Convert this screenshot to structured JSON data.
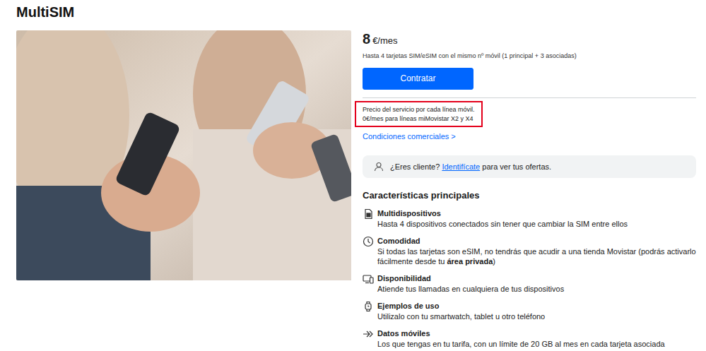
{
  "title": "MultiSIM",
  "price": {
    "amount": "8",
    "unit": "€/mes",
    "note": "Hasta 4 tarjetas SIM/eSIM con el mismo nº móvil (1 principal + 3 asociadas)"
  },
  "cta": "Contratar",
  "pricing_notes": {
    "highlighted": true,
    "lines": [
      "Precio del servicio por cada línea móvil.",
      "0€/mes para líneas miMovistar X2 y X4"
    ]
  },
  "conditions_link": "Condiciones comerciales >",
  "client_banner": {
    "question": "¿Eres cliente?",
    "link": "Identifícate",
    "rest": "para ver tus ofertas."
  },
  "features_title": "Características principales",
  "features": [
    {
      "title": "Multidispositivos",
      "desc": [
        {
          "text": "Hasta 4 dispositivos conectados sin tener que cambiar la SIM entre ellos",
          "bold": false
        }
      ]
    },
    {
      "title": "Comodidad",
      "desc": [
        {
          "text": "Si todas las tarjetas son eSIM, no tendrás que acudir a una tienda Movistar (podrás activarlo fácilmente desde tu ",
          "bold": false
        },
        {
          "text": "área privada",
          "bold": true
        },
        {
          "text": ")",
          "bold": false
        }
      ]
    },
    {
      "title": "Disponibilidad",
      "desc": [
        {
          "text": "Atiende tus llamadas en cualquiera de tus dispositivos",
          "bold": false
        }
      ]
    },
    {
      "title": "Ejemplos de uso",
      "desc": [
        {
          "text": "Utilizalo con tu smartwatch, tablet u otro teléfono",
          "bold": false
        }
      ]
    },
    {
      "title": "Datos móviles",
      "desc": [
        {
          "text": "Los que tengas en tu tarifa, con un límite de 20 GB al mes en cada tarjeta asociada",
          "bold": false
        }
      ]
    }
  ]
}
